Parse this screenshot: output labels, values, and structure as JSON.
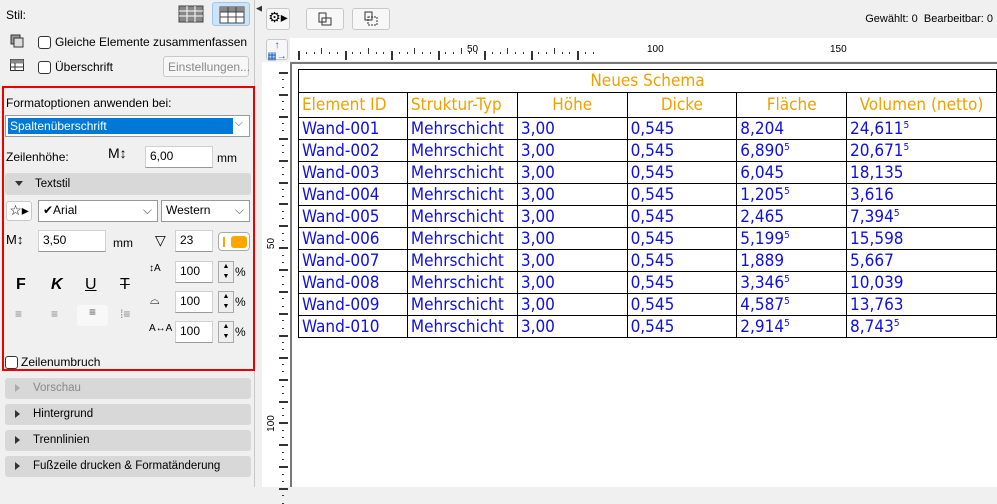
{
  "panel": {
    "stil_label": "Stil:",
    "gleiche_label": "Gleiche Elemente zusammenfassen",
    "ueberschrift_label": "Überschrift",
    "einstellungen_button": "Einstellungen...",
    "format_label": "Formatoptionen anwenden bei:",
    "format_select": "Spaltenüberschrift",
    "zeilenhoehe_label": "Zeilenhöhe:",
    "zeilenhoehe_value": "6,00",
    "zeilenhoehe_unit": "mm",
    "textstil_label": "Textstil",
    "font_value": "✔Arial",
    "script_value": "Western",
    "text_size_value": "3,50",
    "text_size_unit": "mm",
    "pen_value": "23",
    "pen_color": "#ffa500",
    "bold_label": "F",
    "italic_label": "K",
    "underline_label": "U",
    "strike_label": "T",
    "line_spacing_value": "100",
    "width_factor_value": "100",
    "char_spacing_value": "100",
    "percent": "%",
    "zeilenumbruch_label": "Zeilenumbruch",
    "sections": [
      "Vorschau",
      "Hintergrund",
      "Trennlinien",
      "Fußzeile drucken & Formatänderung"
    ]
  },
  "toolbar": {
    "status": "Gewählt: 0  Bearbeitbar: 0"
  },
  "ruler": {
    "h_labels": [
      "50",
      "100",
      "150"
    ],
    "v_labels": [
      "50",
      "100"
    ]
  },
  "schedule": {
    "title": "Neues Schema",
    "title_color": "#f0a000",
    "cell_color": "#1010e0",
    "columns": [
      "Element ID",
      "Struktur-Typ",
      "Höhe",
      "Dicke",
      "Fläche",
      "Volumen (netto)"
    ],
    "rows": [
      [
        "Wand-001",
        "Mehrschicht",
        "3,00",
        "0,545",
        "8,204",
        "24,611⁵"
      ],
      [
        "Wand-002",
        "Mehrschicht",
        "3,00",
        "0,545",
        "6,890⁵",
        "20,671⁵"
      ],
      [
        "Wand-003",
        "Mehrschicht",
        "3,00",
        "0,545",
        "6,045",
        "18,135"
      ],
      [
        "Wand-004",
        "Mehrschicht",
        "3,00",
        "0,545",
        "1,205⁵",
        "3,616"
      ],
      [
        "Wand-005",
        "Mehrschicht",
        "3,00",
        "0,545",
        "2,465",
        "7,394⁵"
      ],
      [
        "Wand-006",
        "Mehrschicht",
        "3,00",
        "0,545",
        "5,199⁵",
        "15,598"
      ],
      [
        "Wand-007",
        "Mehrschicht",
        "3,00",
        "0,545",
        "1,889",
        "5,667"
      ],
      [
        "Wand-008",
        "Mehrschicht",
        "3,00",
        "0,545",
        "3,346⁵",
        "10,039"
      ],
      [
        "Wand-009",
        "Mehrschicht",
        "3,00",
        "0,545",
        "4,587⁵",
        "13,763"
      ],
      [
        "Wand-010",
        "Mehrschicht",
        "3,00",
        "0,545",
        "2,914⁵",
        "8,743⁵"
      ]
    ]
  }
}
